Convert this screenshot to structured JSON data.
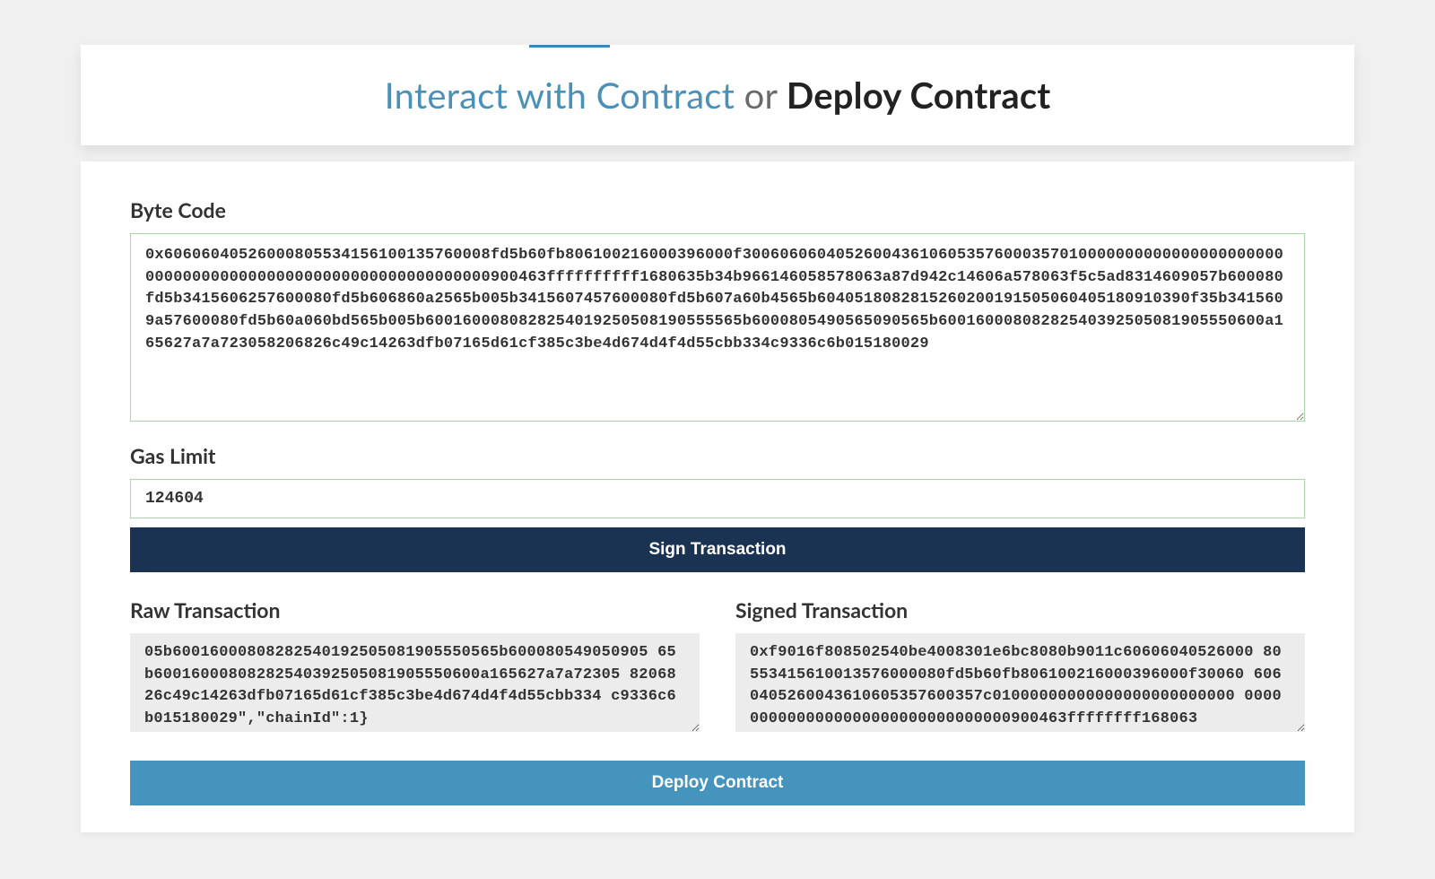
{
  "header": {
    "tab_interact": "Interact with Contract",
    "separator": "or",
    "tab_deploy": "Deploy Contract"
  },
  "form": {
    "bytecode_label": "Byte Code",
    "bytecode_value": "0x60606040526000805534156100135760008fd5b60fb806100216000396000f30060606040526004361060535760003570100000000000000000000000000000000000000000000000000000000000900463ffffffffff1680635b34b966146058578063a87d942c14606a578063f5c5ad8314609057b600080fd5b3415606257600080fd5b606860a2565b005b3415607457600080fd5b607a60b4565b6040518082815260200191505060405180910390f35b3415609a57600080fd5b60a060bd565b005b6001600080828254019250508190555565b6000805490565090565b60016000808282540392505081905550600a165627a7a723058206826c49c14263dfb07165d61cf385c3be4d674d4f4d55cbb334c9336c6b015180029",
    "gas_label": "Gas Limit",
    "gas_value": "124604",
    "sign_button": "Sign Transaction",
    "raw_label": "Raw Transaction",
    "raw_value": "05b60016000808282540192505081905550565b600080549050905 65b60016000808282540392505081905550600a165627a7a72305 8206826c49c14263dfb07165d61cf385c3be4d674d4f4d55cbb334 c9336c6b015180029\",\"chainId\":1}",
    "signed_label": "Signed Transaction",
    "signed_value": "0xf9016f808502540be4008301e6bc8080b9011c60606040526000 80553415610013576000080fd5b60fb806100216000396000f30060 6060405260043610605357600357c01000000000000000000000000 00000000000000000000000000000000900463ffffffff168063",
    "deploy_button": "Deploy Contract"
  }
}
